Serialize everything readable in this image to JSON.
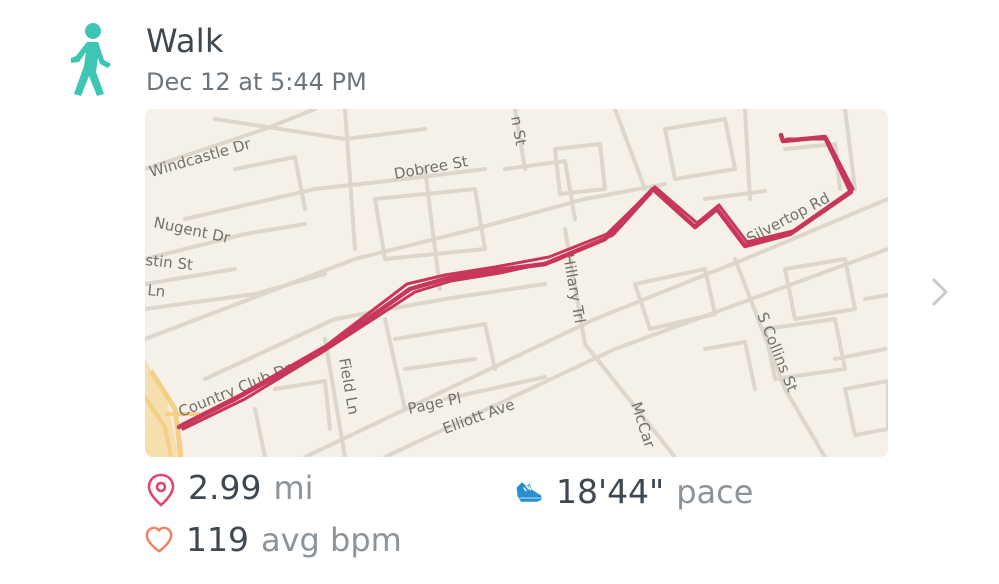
{
  "activity": {
    "title": "Walk",
    "timestamp": "Dec 12 at 5:44 PM",
    "icon": "walking-person-icon",
    "icon_color": "#3ec5b4"
  },
  "map": {
    "route_color": "#c8365a",
    "street_labels": [
      "Windcastle Dr",
      "Dobree St",
      "n St",
      "Nugent Dr",
      "stin St",
      "Ln",
      "Silvertop Rd",
      "Hillary Trl",
      "Country Club Dr",
      "Field Ln",
      "Page Pl",
      "Elliott Ave",
      "S Collins St",
      "McCar"
    ]
  },
  "stats": {
    "distance": {
      "value": "2.99",
      "unit": "mi",
      "icon": "location-pin-icon",
      "icon_color": "#e0466f"
    },
    "pace": {
      "value": "18'44\"",
      "unit": "pace",
      "icon": "running-shoe-icon",
      "icon_color": "#2a8fd0"
    },
    "heart_rate": {
      "value": "119",
      "unit": "avg bpm",
      "icon": "heart-outline-icon",
      "icon_color": "#f2825c"
    }
  },
  "nav": {
    "icon": "chevron-right-icon"
  }
}
